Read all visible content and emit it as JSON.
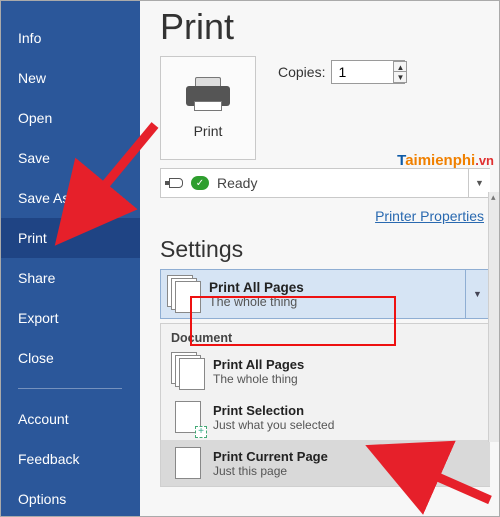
{
  "sidebar": {
    "items": [
      {
        "label": "Info"
      },
      {
        "label": "New"
      },
      {
        "label": "Open"
      },
      {
        "label": "Save"
      },
      {
        "label": "Save As"
      },
      {
        "label": "Print"
      },
      {
        "label": "Share"
      },
      {
        "label": "Export"
      },
      {
        "label": "Close"
      }
    ],
    "footer_items": [
      {
        "label": "Account"
      },
      {
        "label": "Feedback"
      },
      {
        "label": "Options"
      }
    ],
    "selected_index": 5
  },
  "page": {
    "title": "Print"
  },
  "print_button": {
    "label": "Print"
  },
  "copies": {
    "label": "Copies:",
    "value": "1"
  },
  "printer": {
    "status": "Ready",
    "properties_link": "Printer Properties"
  },
  "watermark": {
    "t": "T",
    "rest": "aimienphi",
    "vn": ".vn"
  },
  "settings": {
    "heading": "Settings",
    "selected": {
      "title": "Print All Pages",
      "subtitle": "The whole thing"
    },
    "group_label": "Document",
    "options": [
      {
        "title": "Print All Pages",
        "subtitle": "The whole thing",
        "icon": "multi"
      },
      {
        "title": "Print Selection",
        "subtitle": "Just what you selected",
        "icon": "selection"
      },
      {
        "title": "Print Current Page",
        "subtitle": "Just this page",
        "icon": "single"
      }
    ]
  },
  "colors": {
    "sidebar_bg": "#2b579a",
    "sidebar_selected": "#1f4484",
    "link": "#2969b0",
    "highlight_border": "#e11727",
    "arrow": "#e6202a"
  }
}
